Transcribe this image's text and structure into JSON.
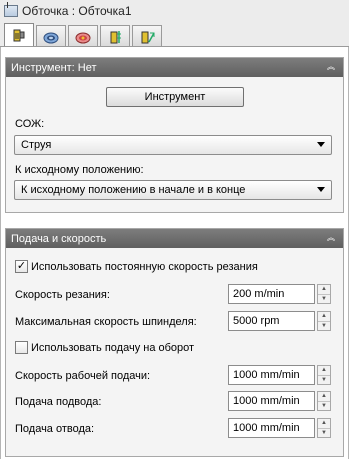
{
  "window": {
    "title": "Обточка : Обточка1"
  },
  "tabs": [
    {
      "icon": "tool-icon"
    },
    {
      "icon": "coolant-icon"
    },
    {
      "icon": "geometry-icon"
    },
    {
      "icon": "heights-icon"
    },
    {
      "icon": "passes-icon"
    }
  ],
  "tool_group": {
    "title": "Инструмент: Нет",
    "tool_button": "Инструмент",
    "coolant_label": "СОЖ:",
    "coolant_value": "Струя",
    "home_label": "К исходному положению:",
    "home_value": "К исходному положению в начале и в конце"
  },
  "feed_group": {
    "title": "Подача и скорость",
    "constant_speed_label": "Использовать постоянную скорость резания",
    "constant_speed_checked": true,
    "cutting_speed_label": "Скорость резания:",
    "cutting_speed_value": "200 m/min",
    "max_spindle_label": "Максимальная скорость шпинделя:",
    "max_spindle_value": "5000 rpm",
    "feed_per_rev_label": "Использовать подачу на оборот",
    "feed_per_rev_checked": false,
    "cutting_feed_label": "Скорость рабочей подачи:",
    "cutting_feed_value": "1000 mm/min",
    "lead_in_label": "Подача подвода:",
    "lead_in_value": "1000 mm/min",
    "lead_out_label": "Подача отвода:",
    "lead_out_value": "1000 mm/min"
  }
}
